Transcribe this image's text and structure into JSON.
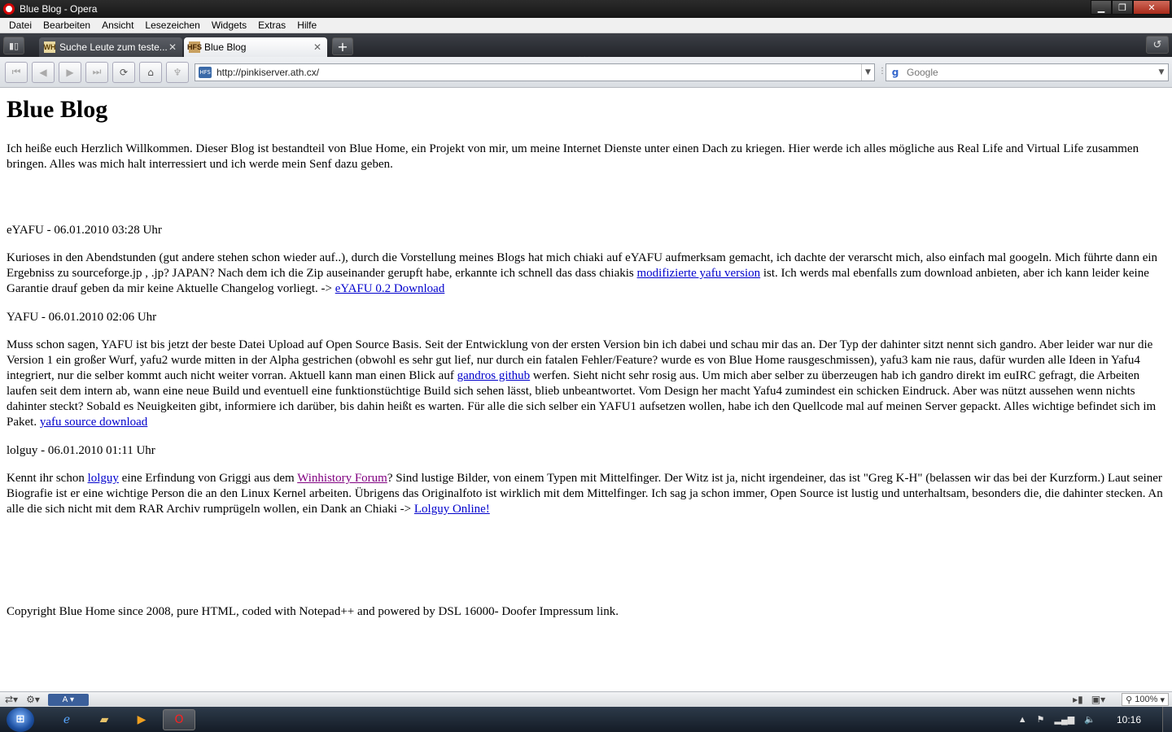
{
  "window": {
    "title": "Blue Blog - Opera",
    "minimize_label": "▁",
    "maximize_label": "❐",
    "close_label": "✕"
  },
  "menu": [
    "Datei",
    "Bearbeiten",
    "Ansicht",
    "Lesezeichen",
    "Widgets",
    "Extras",
    "Hilfe"
  ],
  "tabs": [
    {
      "label": "Suche Leute zum teste...",
      "favicon": "WH",
      "active": false
    },
    {
      "label": "Blue Blog",
      "favicon": "HFS",
      "active": true
    }
  ],
  "address": {
    "url": "http://pinkiserver.ath.cx/",
    "site_icon": "HFS"
  },
  "search": {
    "placeholder": "Google"
  },
  "icons": {
    "panel": "panel-toggle-icon",
    "newtab": "plus-icon",
    "trash": "closed-tabs-icon",
    "first": "rewind-icon",
    "back": "back-arrow-icon",
    "forward": "forward-arrow-icon",
    "last": "fast-forward-icon",
    "reload": "reload-icon",
    "home": "home-icon",
    "wand": "wand-icon",
    "google": "google-icon"
  },
  "page": {
    "heading": "Blue Blog",
    "intro": "Ich heiße euch Herzlich Willkommen. Dieser Blog ist bestandteil von Blue Home, ein Projekt von mir, um meine Internet Dienste unter einen Dach zu kriegen. Hier werde ich alles mögliche aus Real Life and Virtual Life zusammen bringen. Alles was mich halt interressiert und ich werde mein Senf dazu geben.",
    "posts": [
      {
        "title": "eYAFU - 06.01.2010 03:28 Uhr",
        "t1": "Kurioses in den Abendstunden (gut andere stehen schon wieder auf..), durch die Vorstellung meines Blogs hat mich chiaki auf eYAFU aufmerksam gemacht, ich dachte der verarscht mich, also einfach mal googeln. Mich führte dann ein Ergebniss zu sourceforge.jp , .jp? JAPAN? Nach dem ich die Zip auseinander gerupft habe, erkannte ich schnell das dass chiakis ",
        "l1": "modifizierte yafu version",
        "t2": " ist. Ich werds mal ebenfalls zum download anbieten, aber ich kann leider keine Garantie drauf geben da mir keine Aktuelle Changelog vorliegt. -> ",
        "l2": "eYAFU 0.2 Download"
      },
      {
        "title": "YAFU - 06.01.2010 02:06 Uhr",
        "t1": "Muss schon sagen, YAFU ist bis jetzt der beste Datei Upload auf Open Source Basis. Seit der Entwicklung von der ersten Version bin ich dabei und schau mir das an. Der Typ der dahinter sitzt nennt sich gandro. Aber leider war nur die Version 1 ein großer Wurf, yafu2 wurde mitten in der Alpha gestrichen (obwohl es sehr gut lief, nur durch ein fatalen Fehler/Feature? wurde es von Blue Home rausgeschmissen), yafu3 kam nie raus, dafür wurden alle Ideen in Yafu4 integriert, nur die selber kommt auch nicht weiter vorran. Aktuell kann man einen Blick auf ",
        "l1": "gandros github",
        "t2": " werfen. Sieht nicht sehr rosig aus. Um mich aber selber zu überzeugen hab ich gandro direkt im euIRC gefragt, die Arbeiten laufen seit dem intern ab, wann eine neue Build und eventuell eine funktionstüchtige Build sich sehen lässt, blieb unbeantwortet. Vom Design her macht Yafu4 zumindest ein schicken Eindruck. Aber was nützt aussehen wenn nichts dahinter steckt? Sobald es Neuigkeiten gibt, informiere ich darüber, bis dahin heißt es warten. Für alle die sich selber ein YAFU1 aufsetzen wollen, habe ich den Quellcode mal auf meinen Server gepackt. Alles wichtige befindet sich im Paket. ",
        "l2": "yafu source download"
      },
      {
        "title": "lolguy - 06.01.2010 01:11 Uhr",
        "t1": "Kennt ihr schon ",
        "l1": "lolguy",
        "t2": " eine Erfindung von Griggi aus dem ",
        "l2": "Winhistory Forum",
        "t3": "? Sind lustige Bilder, von einem Typen mit Mittelfinger. Der Witz ist ja, nicht irgendeiner, das ist \"Greg K-H\" (belassen wir das bei der Kurzform.) Laut seiner Biografie ist er eine wichtige Person die an den Linux Kernel arbeiten. Übrigens das Originalfoto ist wirklich mit dem Mittelfinger. Ich sag ja schon immer, Open Source ist lustig und unterhaltsam, besonders die, die dahinter stecken. An alle die sich nicht mit dem RAR Archiv rumprügeln wollen, ein Dank an Chiaki -> ",
        "l3": "Lolguy Online!"
      }
    ],
    "footer": "Copyright Blue Home since 2008, pure HTML, coded with Notepad++ and powered by DSL 16000- Doofer Impressum link."
  },
  "statusbar": {
    "view_label": "A",
    "zoom": "100%"
  },
  "taskbar": {
    "clock": "10:16"
  },
  "colors": {
    "link": "#0000cc",
    "visited_link": "#800080",
    "close_button": "#c0392b"
  }
}
